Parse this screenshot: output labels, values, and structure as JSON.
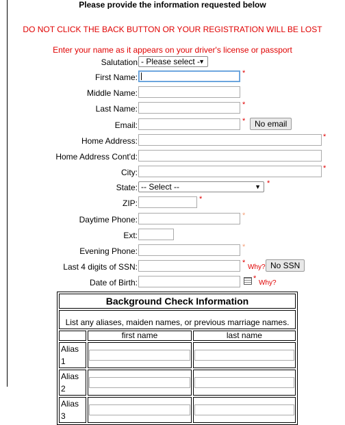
{
  "header": {
    "instructions": "Please provide the information requested below",
    "warning": "DO NOT CLICK THE BACK BUTTON OR YOUR REGISTRATION WILL BE LOST",
    "name_instruction": "Enter your name as it appears on your driver's license or passport"
  },
  "form": {
    "salutation": {
      "label": "Salutation",
      "value": "- Please select -"
    },
    "first_name": {
      "label": "First Name:",
      "value": ""
    },
    "middle_name": {
      "label": "Middle Name:",
      "value": ""
    },
    "last_name": {
      "label": "Last Name:",
      "value": ""
    },
    "email": {
      "label": "Email:",
      "value": "",
      "no_email_button": "No email"
    },
    "home_address": {
      "label": "Home Address:",
      "value": ""
    },
    "home_address_contd": {
      "label": "Home Address Cont'd:",
      "value": ""
    },
    "city": {
      "label": "City:",
      "value": ""
    },
    "state": {
      "label": "State:",
      "value": "-- Select --"
    },
    "zip": {
      "label": "ZIP:",
      "value": ""
    },
    "daytime_phone": {
      "label": "Daytime Phone:",
      "value": ""
    },
    "ext": {
      "label": "Ext:",
      "value": ""
    },
    "evening_phone": {
      "label": "Evening Phone:",
      "value": ""
    },
    "ssn_last4": {
      "label": "Last 4 digits of SSN:",
      "value": "",
      "why": "Why?",
      "no_ssn_button": "No SSN"
    },
    "dob": {
      "label": "Date of Birth:",
      "value": "",
      "why": "Why?"
    },
    "required_marker": "*"
  },
  "background_check": {
    "title": "Background Check Information",
    "subtitle": "List any aliases, maiden names, or previous marriage names.",
    "columns": [
      "first name",
      "last name"
    ],
    "rows": [
      "Alias 1",
      "Alias 2",
      "Alias 3"
    ]
  },
  "colors": {
    "warning": "#e00000",
    "focus": "#5b9bd5"
  }
}
